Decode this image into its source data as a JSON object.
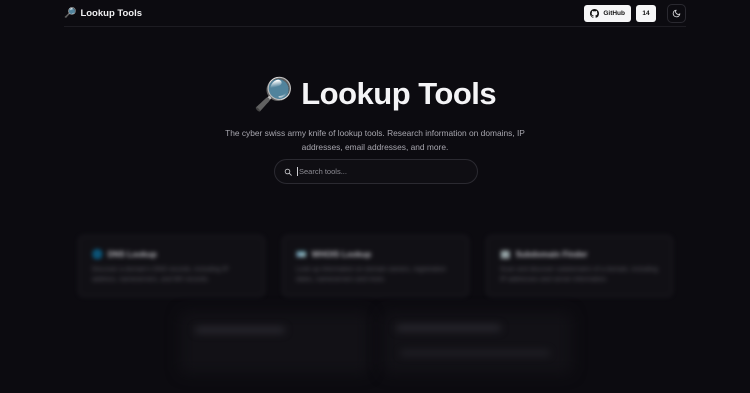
{
  "header": {
    "brand": "Lookup Tools",
    "brand_icon": "magnifier-icon",
    "github_label": "GitHub",
    "star_count": "14",
    "theme_icon": "moon-icon"
  },
  "hero": {
    "title": "Lookup Tools",
    "subtitle": "The cyber swiss army knife of lookup tools. Research information on domains, IP addresses, email addresses, and more."
  },
  "search": {
    "placeholder": "Search tools..."
  },
  "tools": [
    {
      "name": "DNS Lookup",
      "icon": "globe-icon",
      "description": "Discover a domain's DNS records, including IP address, nameservers, and MX records."
    },
    {
      "name": "WHOIS Lookup",
      "icon": "id-card-icon",
      "description": "Look up information on domain owners, registration dates, nameservers and more."
    },
    {
      "name": "Subdomain Finder",
      "icon": "building-icon",
      "description": "Scan and discover subdomains of a domain, including IP addresses and server information."
    }
  ],
  "colors": {
    "background": "#0c0b10",
    "card": "#131217",
    "button": "#f6f6f7"
  }
}
